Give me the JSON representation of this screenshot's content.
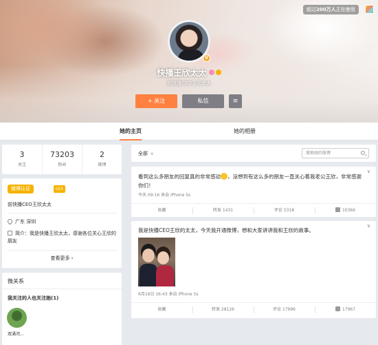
{
  "header": {
    "users_badge_prefix": "超过",
    "users_badge_count": "200万人",
    "users_badge_suffix": "正在使用",
    "name": "快播王欣太太",
    "bio": "前快播CEO王欣太太",
    "follow_label": "+ 关注",
    "message_label": "私信",
    "more_label": "≡"
  },
  "tabs": [
    {
      "label": "她的主页"
    },
    {
      "label": "她的相册"
    }
  ],
  "stats": [
    {
      "value": "3",
      "label": "关注"
    },
    {
      "value": "73203",
      "label": "粉丝"
    },
    {
      "value": "2",
      "label": "微博"
    }
  ],
  "profile": {
    "verify_badge": "微博认证",
    "level": "LV3",
    "verify_desc": "前快播CEO王欣太太",
    "location": "广东 深圳",
    "intro_label": "简介：",
    "intro_text": "我是快播王欣太太，感谢各位关心王欣的朋友",
    "more_label": "查看更多 ›"
  },
  "friends": {
    "title": "微关系",
    "subtitle": "我关注的人也关注她(1)",
    "friend_name": "双涌河..."
  },
  "feed": {
    "filter_label": "全部",
    "search_placeholder": "搜索她的微博",
    "posts": [
      {
        "text_a": "看到这么多朋友的回复真的非常感动",
        "text_b": "，没想到有这么多的朋友一直关心着我老公王欣，非常感谢你们！",
        "meta": "今天 09:16 来自 iPhone 5s",
        "actions": {
          "collect": "收藏",
          "repost": "转发 1431",
          "comment": "评论 5318",
          "like": "10366"
        }
      },
      {
        "text": "我是快播CEO王欣的太太，今天我开通微博，想和大家讲讲我和王欣的故事。",
        "meta": "6月16日 16:43 来自 iPhone 5s",
        "actions": {
          "collect": "收藏",
          "repost": "转发 28126",
          "comment": "评论 17996",
          "like": "17967"
        }
      }
    ]
  },
  "colors": {
    "accent": "#ff8140",
    "gold": "#f5b301",
    "gray_button": "#7e7e84"
  },
  "icons": [
    "skin-icon",
    "verified-icon",
    "gender-icon",
    "location-icon",
    "intro-icon",
    "chevron-down-icon",
    "search-icon",
    "like-icon",
    "menu-icon"
  ]
}
